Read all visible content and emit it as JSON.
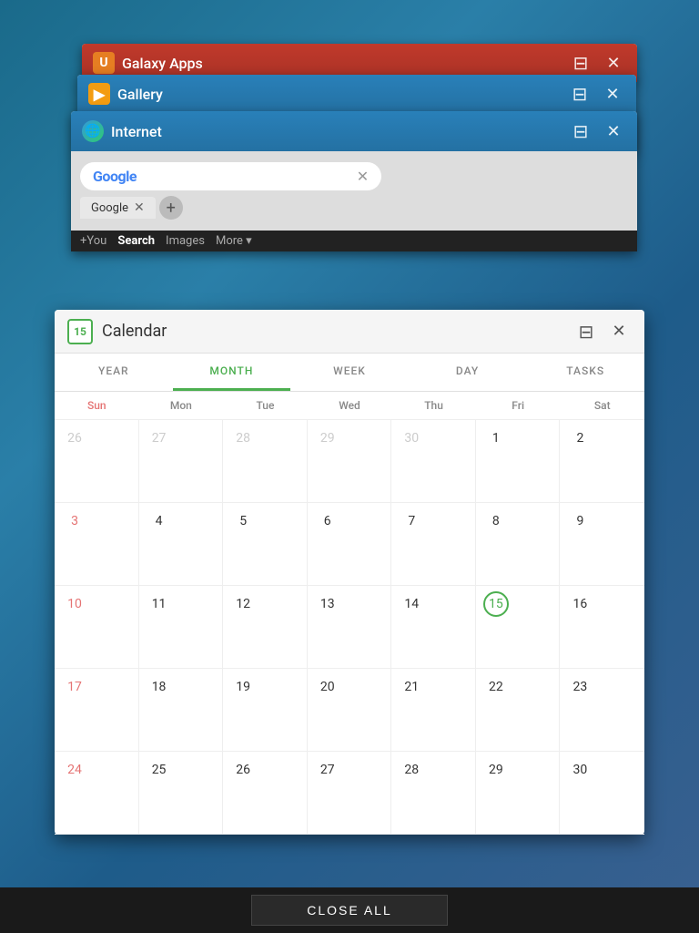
{
  "windows": {
    "galaxy_apps": {
      "title": "Galaxy Apps",
      "icon": "U",
      "minimize_label": "⊟",
      "close_label": "✕"
    },
    "gallery": {
      "title": "Gallery",
      "icon": "▶",
      "minimize_label": "⊟",
      "close_label": "✕"
    },
    "internet": {
      "title": "Internet",
      "icon": "🌐",
      "minimize_label": "⊟",
      "close_label": "✕",
      "tab_label": "Google",
      "nav_items": [
        "+You",
        "Search",
        "Images",
        "More ▾"
      ]
    },
    "calendar": {
      "title": "Calendar",
      "minimize_label": "⊟",
      "close_label": "✕",
      "tabs": [
        "YEAR",
        "MONTH",
        "WEEK",
        "DAY",
        "TASKS"
      ],
      "active_tab": "MONTH",
      "day_headers": [
        "Sun",
        "Mon",
        "Tue",
        "Wed",
        "Thu",
        "Fri",
        "Sat"
      ],
      "weeks": [
        [
          "26",
          "27",
          "28",
          "29",
          "30",
          "1",
          "2"
        ],
        [
          "3",
          "4",
          "5",
          "6",
          "7",
          "8",
          "9"
        ],
        [
          "10",
          "11",
          "12",
          "13",
          "14",
          "15",
          "16"
        ],
        [
          "17",
          "18",
          "19",
          "20",
          "21",
          "22",
          "23"
        ],
        [
          "24",
          "25",
          "26",
          "27",
          "28",
          "29",
          "30"
        ]
      ],
      "today": "15",
      "prev_month_days": [
        "26",
        "27",
        "28",
        "29",
        "30"
      ],
      "current_date": "15"
    }
  },
  "close_all": {
    "label": "CLOSE ALL"
  }
}
